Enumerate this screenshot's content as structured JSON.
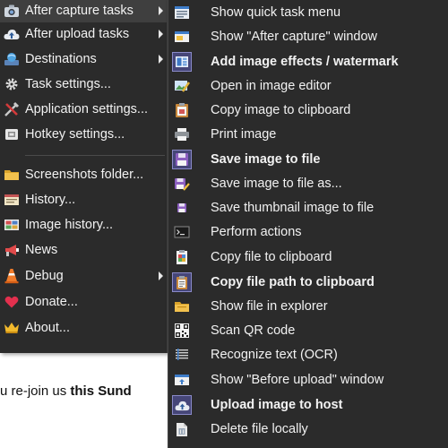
{
  "background": {
    "text_before": "u re-join us ",
    "text_bold": "this Sund"
  },
  "main_menu": {
    "items": [
      {
        "label": "After capture tasks",
        "icon": "camera-icon",
        "has_submenu": true
      },
      {
        "label": "After upload tasks",
        "icon": "cloud-upload-icon",
        "has_submenu": true
      },
      {
        "label": "Destinations",
        "icon": "destinations-icon",
        "has_submenu": true
      },
      {
        "label": "Task settings...",
        "icon": "gear-icon",
        "has_submenu": false
      },
      {
        "label": "Application settings...",
        "icon": "tools-icon",
        "has_submenu": false
      },
      {
        "label": "Hotkey settings...",
        "icon": "keyboard-icon",
        "has_submenu": false
      },
      {
        "label": "Screenshots folder...",
        "icon": "folder-icon",
        "has_submenu": false
      },
      {
        "label": "History...",
        "icon": "history-icon",
        "has_submenu": false
      },
      {
        "label": "Image history...",
        "icon": "image-history-icon",
        "has_submenu": false
      },
      {
        "label": "News",
        "icon": "megaphone-icon",
        "has_submenu": false
      },
      {
        "label": "Debug",
        "icon": "traffic-cone-icon",
        "has_submenu": true
      },
      {
        "label": "Donate...",
        "icon": "heart-icon",
        "has_submenu": false
      },
      {
        "label": "About...",
        "icon": "crown-icon",
        "has_submenu": false
      }
    ]
  },
  "submenu": {
    "items": [
      {
        "label": "Show quick task menu",
        "icon": "quick-task-menu-icon",
        "checked": false
      },
      {
        "label": "Show \"After capture\" window",
        "icon": "after-capture-window-icon",
        "checked": false
      },
      {
        "label": "Add image effects / watermark",
        "icon": "image-effects-icon",
        "checked": true
      },
      {
        "label": "Open in image editor",
        "icon": "image-editor-icon",
        "checked": false
      },
      {
        "label": "Copy image to clipboard",
        "icon": "clipboard-image-icon",
        "checked": false
      },
      {
        "label": "Print image",
        "icon": "printer-icon",
        "checked": false
      },
      {
        "label": "Save image to file",
        "icon": "floppy-disk-icon",
        "checked": true
      },
      {
        "label": "Save image to file as...",
        "icon": "save-as-icon",
        "checked": false
      },
      {
        "label": "Save thumbnail image to file",
        "icon": "save-thumbnail-icon",
        "checked": false
      },
      {
        "label": "Perform actions",
        "icon": "terminal-icon",
        "checked": false
      },
      {
        "label": "Copy file to clipboard",
        "icon": "copy-file-icon",
        "checked": false
      },
      {
        "label": "Copy file path to clipboard",
        "icon": "clipboard-path-icon",
        "checked": true
      },
      {
        "label": "Show file in explorer",
        "icon": "explorer-folder-icon",
        "checked": false
      },
      {
        "label": "Scan QR code",
        "icon": "qr-code-icon",
        "checked": false
      },
      {
        "label": "Recognize text (OCR)",
        "icon": "ocr-icon",
        "checked": false
      },
      {
        "label": "Show \"Before upload\" window",
        "icon": "before-upload-window-icon",
        "checked": false
      },
      {
        "label": "Upload image to host",
        "icon": "cloud-upload-icon",
        "checked": true
      },
      {
        "label": "Delete file locally",
        "icon": "delete-file-icon",
        "checked": false
      }
    ]
  },
  "colors": {
    "menu_background": "#2b2b2b",
    "menu_text": "#f2f2f2",
    "checked_background": "#464678",
    "checked_border": "#8a8ac8"
  }
}
